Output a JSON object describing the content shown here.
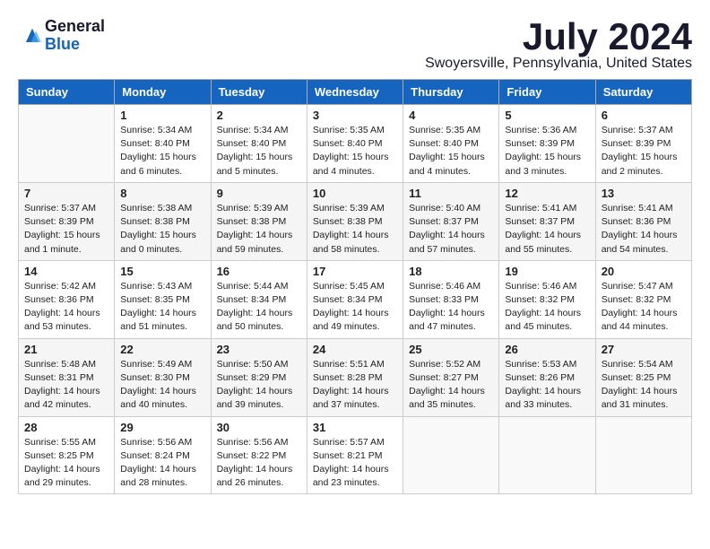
{
  "header": {
    "logo_general": "General",
    "logo_blue": "Blue",
    "month_title": "July 2024",
    "location": "Swoyersville, Pennsylvania, United States"
  },
  "days_of_week": [
    "Sunday",
    "Monday",
    "Tuesday",
    "Wednesday",
    "Thursday",
    "Friday",
    "Saturday"
  ],
  "weeks": [
    [
      {
        "day": "",
        "sunrise": "",
        "sunset": "",
        "daylight": ""
      },
      {
        "day": "1",
        "sunrise": "Sunrise: 5:34 AM",
        "sunset": "Sunset: 8:40 PM",
        "daylight": "Daylight: 15 hours and 6 minutes."
      },
      {
        "day": "2",
        "sunrise": "Sunrise: 5:34 AM",
        "sunset": "Sunset: 8:40 PM",
        "daylight": "Daylight: 15 hours and 5 minutes."
      },
      {
        "day": "3",
        "sunrise": "Sunrise: 5:35 AM",
        "sunset": "Sunset: 8:40 PM",
        "daylight": "Daylight: 15 hours and 4 minutes."
      },
      {
        "day": "4",
        "sunrise": "Sunrise: 5:35 AM",
        "sunset": "Sunset: 8:40 PM",
        "daylight": "Daylight: 15 hours and 4 minutes."
      },
      {
        "day": "5",
        "sunrise": "Sunrise: 5:36 AM",
        "sunset": "Sunset: 8:39 PM",
        "daylight": "Daylight: 15 hours and 3 minutes."
      },
      {
        "day": "6",
        "sunrise": "Sunrise: 5:37 AM",
        "sunset": "Sunset: 8:39 PM",
        "daylight": "Daylight: 15 hours and 2 minutes."
      }
    ],
    [
      {
        "day": "7",
        "sunrise": "Sunrise: 5:37 AM",
        "sunset": "Sunset: 8:39 PM",
        "daylight": "Daylight: 15 hours and 1 minute."
      },
      {
        "day": "8",
        "sunrise": "Sunrise: 5:38 AM",
        "sunset": "Sunset: 8:38 PM",
        "daylight": "Daylight: 15 hours and 0 minutes."
      },
      {
        "day": "9",
        "sunrise": "Sunrise: 5:39 AM",
        "sunset": "Sunset: 8:38 PM",
        "daylight": "Daylight: 14 hours and 59 minutes."
      },
      {
        "day": "10",
        "sunrise": "Sunrise: 5:39 AM",
        "sunset": "Sunset: 8:38 PM",
        "daylight": "Daylight: 14 hours and 58 minutes."
      },
      {
        "day": "11",
        "sunrise": "Sunrise: 5:40 AM",
        "sunset": "Sunset: 8:37 PM",
        "daylight": "Daylight: 14 hours and 57 minutes."
      },
      {
        "day": "12",
        "sunrise": "Sunrise: 5:41 AM",
        "sunset": "Sunset: 8:37 PM",
        "daylight": "Daylight: 14 hours and 55 minutes."
      },
      {
        "day": "13",
        "sunrise": "Sunrise: 5:41 AM",
        "sunset": "Sunset: 8:36 PM",
        "daylight": "Daylight: 14 hours and 54 minutes."
      }
    ],
    [
      {
        "day": "14",
        "sunrise": "Sunrise: 5:42 AM",
        "sunset": "Sunset: 8:36 PM",
        "daylight": "Daylight: 14 hours and 53 minutes."
      },
      {
        "day": "15",
        "sunrise": "Sunrise: 5:43 AM",
        "sunset": "Sunset: 8:35 PM",
        "daylight": "Daylight: 14 hours and 51 minutes."
      },
      {
        "day": "16",
        "sunrise": "Sunrise: 5:44 AM",
        "sunset": "Sunset: 8:34 PM",
        "daylight": "Daylight: 14 hours and 50 minutes."
      },
      {
        "day": "17",
        "sunrise": "Sunrise: 5:45 AM",
        "sunset": "Sunset: 8:34 PM",
        "daylight": "Daylight: 14 hours and 49 minutes."
      },
      {
        "day": "18",
        "sunrise": "Sunrise: 5:46 AM",
        "sunset": "Sunset: 8:33 PM",
        "daylight": "Daylight: 14 hours and 47 minutes."
      },
      {
        "day": "19",
        "sunrise": "Sunrise: 5:46 AM",
        "sunset": "Sunset: 8:32 PM",
        "daylight": "Daylight: 14 hours and 45 minutes."
      },
      {
        "day": "20",
        "sunrise": "Sunrise: 5:47 AM",
        "sunset": "Sunset: 8:32 PM",
        "daylight": "Daylight: 14 hours and 44 minutes."
      }
    ],
    [
      {
        "day": "21",
        "sunrise": "Sunrise: 5:48 AM",
        "sunset": "Sunset: 8:31 PM",
        "daylight": "Daylight: 14 hours and 42 minutes."
      },
      {
        "day": "22",
        "sunrise": "Sunrise: 5:49 AM",
        "sunset": "Sunset: 8:30 PM",
        "daylight": "Daylight: 14 hours and 40 minutes."
      },
      {
        "day": "23",
        "sunrise": "Sunrise: 5:50 AM",
        "sunset": "Sunset: 8:29 PM",
        "daylight": "Daylight: 14 hours and 39 minutes."
      },
      {
        "day": "24",
        "sunrise": "Sunrise: 5:51 AM",
        "sunset": "Sunset: 8:28 PM",
        "daylight": "Daylight: 14 hours and 37 minutes."
      },
      {
        "day": "25",
        "sunrise": "Sunrise: 5:52 AM",
        "sunset": "Sunset: 8:27 PM",
        "daylight": "Daylight: 14 hours and 35 minutes."
      },
      {
        "day": "26",
        "sunrise": "Sunrise: 5:53 AM",
        "sunset": "Sunset: 8:26 PM",
        "daylight": "Daylight: 14 hours and 33 minutes."
      },
      {
        "day": "27",
        "sunrise": "Sunrise: 5:54 AM",
        "sunset": "Sunset: 8:25 PM",
        "daylight": "Daylight: 14 hours and 31 minutes."
      }
    ],
    [
      {
        "day": "28",
        "sunrise": "Sunrise: 5:55 AM",
        "sunset": "Sunset: 8:25 PM",
        "daylight": "Daylight: 14 hours and 29 minutes."
      },
      {
        "day": "29",
        "sunrise": "Sunrise: 5:56 AM",
        "sunset": "Sunset: 8:24 PM",
        "daylight": "Daylight: 14 hours and 28 minutes."
      },
      {
        "day": "30",
        "sunrise": "Sunrise: 5:56 AM",
        "sunset": "Sunset: 8:22 PM",
        "daylight": "Daylight: 14 hours and 26 minutes."
      },
      {
        "day": "31",
        "sunrise": "Sunrise: 5:57 AM",
        "sunset": "Sunset: 8:21 PM",
        "daylight": "Daylight: 14 hours and 23 minutes."
      },
      {
        "day": "",
        "sunrise": "",
        "sunset": "",
        "daylight": ""
      },
      {
        "day": "",
        "sunrise": "",
        "sunset": "",
        "daylight": ""
      },
      {
        "day": "",
        "sunrise": "",
        "sunset": "",
        "daylight": ""
      }
    ]
  ]
}
